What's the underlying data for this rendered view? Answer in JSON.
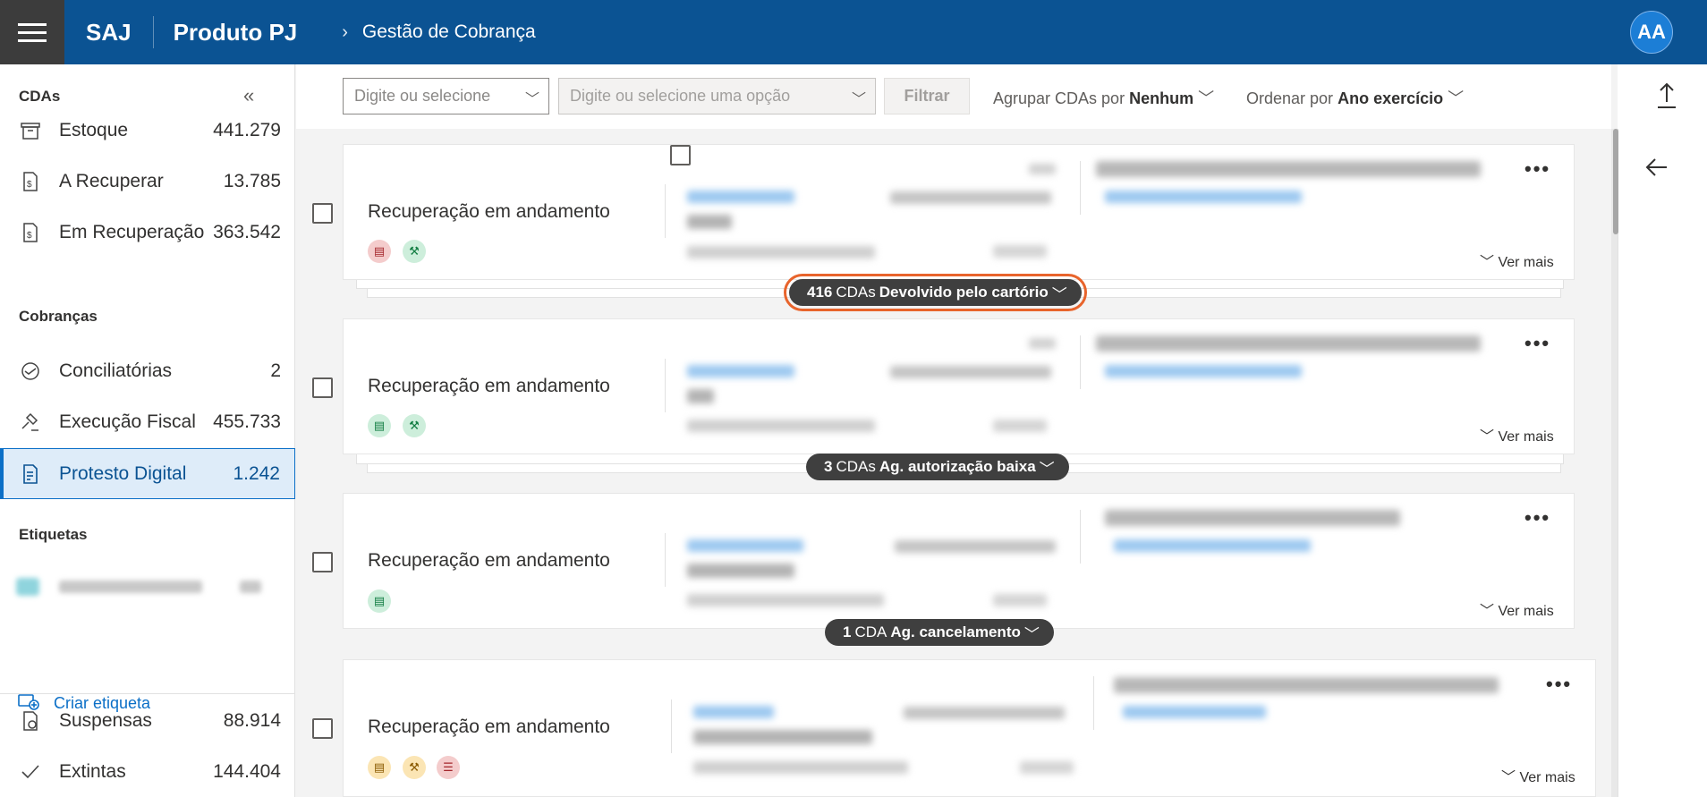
{
  "header": {
    "brand": "SAJ",
    "product": "Produto PJ",
    "breadcrumb": "Gestão de Cobrança",
    "avatar": "AA"
  },
  "sidebar": {
    "cdas_title": "CDAs",
    "cobrancas_title": "Cobranças",
    "etiquetas_title": "Etiquetas",
    "create_tag": "Criar etiqueta",
    "items": [
      {
        "label": "Estoque",
        "count": "441.279",
        "icon": "archive-icon"
      },
      {
        "label": "A Recuperar",
        "count": "13.785",
        "icon": "document-dollar-icon"
      },
      {
        "label": "Em Recuperação",
        "count": "363.542",
        "icon": "document-dollar-icon"
      },
      {
        "label": "Conciliatórias",
        "count": "2",
        "icon": "handshake-icon"
      },
      {
        "label": "Execução Fiscal",
        "count": "455.733",
        "icon": "gavel-icon"
      },
      {
        "label": "Protesto Digital",
        "count": "1.242",
        "icon": "document-protest-icon"
      },
      {
        "label": "Suspensas",
        "count": "88.914",
        "icon": "document-pause-icon"
      },
      {
        "label": "Extintas",
        "count": "144.404",
        "icon": "check-icon"
      }
    ]
  },
  "filters": {
    "select1_placeholder": "Digite ou selecione",
    "select2_placeholder": "Digite ou selecione uma opção",
    "filter_button": "Filtrar",
    "group_prefix": "Agrupar CDAs por",
    "group_value": "Nenhum",
    "order_prefix": "Ordenar por",
    "order_value": "Ano exercício"
  },
  "cards": [
    {
      "status": "Recuperação em andamento",
      "more": "•••",
      "ver_mais": "Ver mais",
      "badges": [
        "red",
        "green"
      ]
    },
    {
      "status": "Recuperação em andamento",
      "more": "•••",
      "ver_mais": "Ver mais",
      "badges": [
        "green",
        "green"
      ]
    },
    {
      "status": "Recuperação em andamento",
      "more": "•••",
      "ver_mais": "Ver mais",
      "badges": [
        "green"
      ]
    },
    {
      "status": "Recuperação em andamento",
      "more": "•••",
      "ver_mais": "Ver mais",
      "badges": [
        "yellow",
        "yellow",
        "red"
      ]
    }
  ],
  "groups": [
    {
      "count": "416",
      "unit": "CDAs",
      "status": "Devolvido pelo cartório"
    },
    {
      "count": "3",
      "unit": "CDAs",
      "status": "Ag. autorização baixa"
    },
    {
      "count": "1",
      "unit": "CDA",
      "status": "Ag. cancelamento"
    }
  ],
  "colors": {
    "header_bg": "#0b5393",
    "accent": "#0b6fc7",
    "highlight_outline": "#e8642c"
  }
}
